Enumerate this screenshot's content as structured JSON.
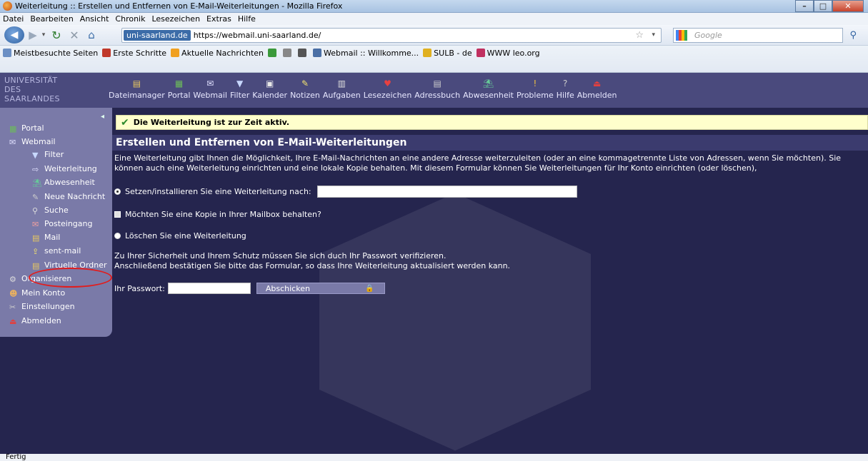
{
  "window": {
    "title": "Weiterleitung :: Erstellen und Entfernen von E-Mail-Weiterleitungen - Mozilla Firefox"
  },
  "menubar": [
    "Datei",
    "Bearbeiten",
    "Ansicht",
    "Chronik",
    "Lesezeichen",
    "Extras",
    "Hilfe"
  ],
  "nav": {
    "site_id": "uni-saarland.de",
    "url": "https://webmail.uni-saarland.de/",
    "search_placeholder": "Google"
  },
  "bookmarks": [
    {
      "label": "Meistbesuchte Seiten",
      "color": "#6b8fc4"
    },
    {
      "label": "Erste Schritte",
      "color": "#c0392b"
    },
    {
      "label": "Aktuelle Nachrichten",
      "color": "#f0a020"
    },
    {
      "label": "",
      "color": "#3b9a3b"
    },
    {
      "label": "",
      "color": "#888888"
    },
    {
      "label": "",
      "color": "#555555"
    },
    {
      "label": "Webmail :: Willkomme...",
      "color": "#4a6fa5"
    },
    {
      "label": "SULB - de",
      "color": "#e0b020"
    },
    {
      "label": "WWW leo.org",
      "color": "#c03060"
    }
  ],
  "header": {
    "logo_line1": "UNIVERSITÄT",
    "logo_line2": "DES",
    "logo_line3": "SAARLANDES"
  },
  "toolbar": [
    {
      "label": "Dateimanager",
      "icon": "folder-icon"
    },
    {
      "label": "Portal",
      "icon": "portal-icon"
    },
    {
      "label": "Webmail",
      "icon": "mail-icon"
    },
    {
      "label": "Filter",
      "icon": "filter-icon"
    },
    {
      "label": "Kalender",
      "icon": "calendar-icon"
    },
    {
      "label": "Notizen",
      "icon": "notes-icon"
    },
    {
      "label": "Aufgaben",
      "icon": "tasks-icon"
    },
    {
      "label": "Lesezeichen",
      "icon": "bookmark-heart-icon"
    },
    {
      "label": "Adressbuch",
      "icon": "addressbook-icon"
    },
    {
      "label": "Abwesenheit",
      "icon": "vacation-icon"
    },
    {
      "label": "Probleme",
      "icon": "problems-icon"
    },
    {
      "label": "Hilfe",
      "icon": "help-icon"
    },
    {
      "label": "Abmelden",
      "icon": "logout-icon"
    }
  ],
  "sidebar": [
    {
      "label": "Portal",
      "icon": "portal-icon"
    },
    {
      "label": "Webmail",
      "icon": "mail-icon"
    },
    {
      "label": "Filter",
      "icon": "filter-icon"
    },
    {
      "label": "Weiterleitung",
      "icon": "forward-arrow-icon"
    },
    {
      "label": "Abwesenheit",
      "icon": "vacation-icon"
    },
    {
      "label": "Neue Nachricht",
      "icon": "new-message-icon"
    },
    {
      "label": "Suche",
      "icon": "search-icon"
    },
    {
      "label": "Posteingang",
      "icon": "inbox-icon"
    },
    {
      "label": "Mail",
      "icon": "folder-icon"
    },
    {
      "label": "sent-mail",
      "icon": "sent-icon"
    },
    {
      "label": "Virtuelle Ordner",
      "icon": "folder-icon"
    },
    {
      "label": "Organisieren",
      "icon": "organize-icon"
    },
    {
      "label": "Mein Konto",
      "icon": "user-icon"
    },
    {
      "label": "Einstellungen",
      "icon": "settings-icon"
    },
    {
      "label": "Abmelden",
      "icon": "logout-icon"
    }
  ],
  "notice": "Die Weiterleitung ist zur Zeit aktiv.",
  "page": {
    "title": "Erstellen und Entfernen von E-Mail-Weiterleitungen",
    "explain": "Eine Weiterleitung gibt Ihnen die Möglichkeit, Ihre E-Mail-Nachrichten an eine andere Adresse weiterzuleiten (oder an eine kommagetrennte Liste von Adressen, wenn Sie möchten). Sie können auch eine Weiterleitung einrichten und eine lokale Kopie behalten.   Mit diesem Formular können Sie Weiterleitungen für Ihr Konto einrichten (oder löschen),",
    "opt_set": "Setzen/installieren Sie eine Weiterleitung nach:",
    "opt_set_value": "",
    "opt_copy": "Möchten Sie eine Kopie in Ihrer Mailbox behalten?",
    "opt_delete": "Löschen Sie eine Weiterleitung",
    "security1": "Zu Ihrer Sicherheit und Ihrem Schutz müssen Sie sich duch Ihr Passwort verifizieren.",
    "security2": "Anschließend bestätigen Sie bitte das Formular, so dass Ihre Weiterleitung aktualisiert werden kann.",
    "pw_label": "Ihr Passwort:",
    "pw_value": "",
    "submit_label": "Abschicken"
  },
  "status": "Fertig",
  "colors": {
    "header_bg": "#4a4a7d",
    "sidebar_bg": "#7a7aa8",
    "content_bg": "#25254e",
    "notice_bg": "#ffffcc",
    "highlight": "#e21c1c"
  }
}
